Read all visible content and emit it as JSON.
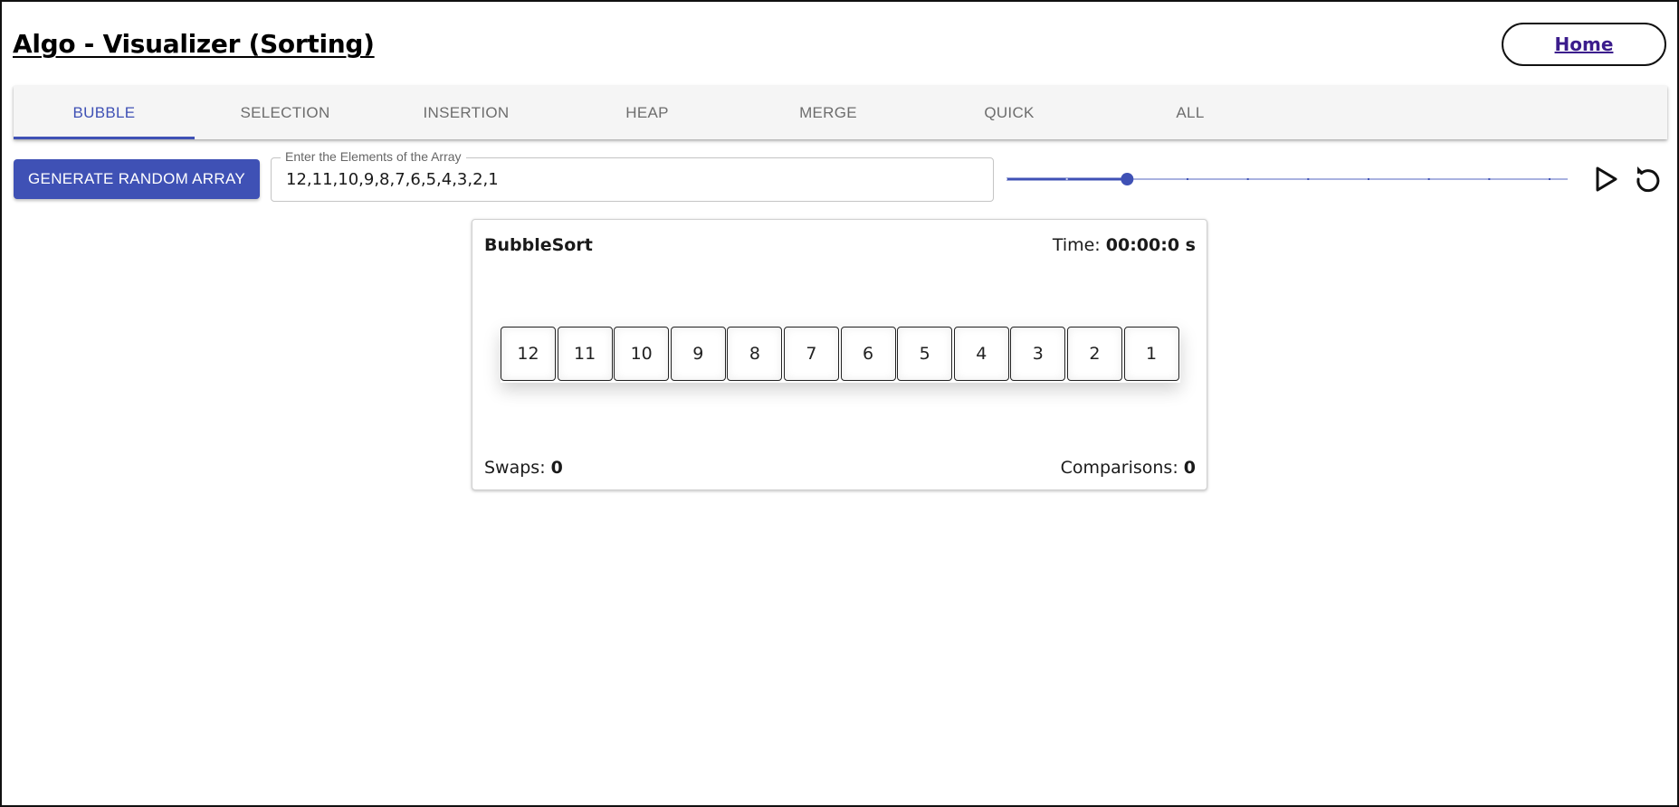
{
  "header": {
    "title": "Algo - Visualizer (Sorting)",
    "home_label": "Home"
  },
  "tabs": [
    {
      "label": "BUBBLE",
      "active": true
    },
    {
      "label": "SELECTION",
      "active": false
    },
    {
      "label": "INSERTION",
      "active": false
    },
    {
      "label": "HEAP",
      "active": false
    },
    {
      "label": "MERGE",
      "active": false
    },
    {
      "label": "QUICK",
      "active": false
    },
    {
      "label": "ALL",
      "active": false
    }
  ],
  "controls": {
    "generate_label": "GENERATE RANDOM ARRAY",
    "array_field_label": "Enter the Elements of the Array",
    "array_value": "12,11,10,9,8,7,6,5,4,3,2,1",
    "speed": {
      "value": 2,
      "min": 0,
      "max": 9,
      "steps": 10
    }
  },
  "card": {
    "title": "BubbleSort",
    "time_label": "Time:",
    "time_value": "00:00:0 s",
    "elements": [
      "12",
      "11",
      "10",
      "9",
      "8",
      "7",
      "6",
      "5",
      "4",
      "3",
      "2",
      "1"
    ],
    "swaps_label": "Swaps:",
    "swaps_value": "0",
    "comparisons_label": "Comparisons:",
    "comparisons_value": "0"
  },
  "colors": {
    "accent": "#3f51b5",
    "slider_rail": "#a9b2e0",
    "tab_bar": "#f5f5f5",
    "home_text": "#3b1c8c"
  },
  "icons": {
    "play": "play-icon",
    "reset": "reset-icon"
  }
}
